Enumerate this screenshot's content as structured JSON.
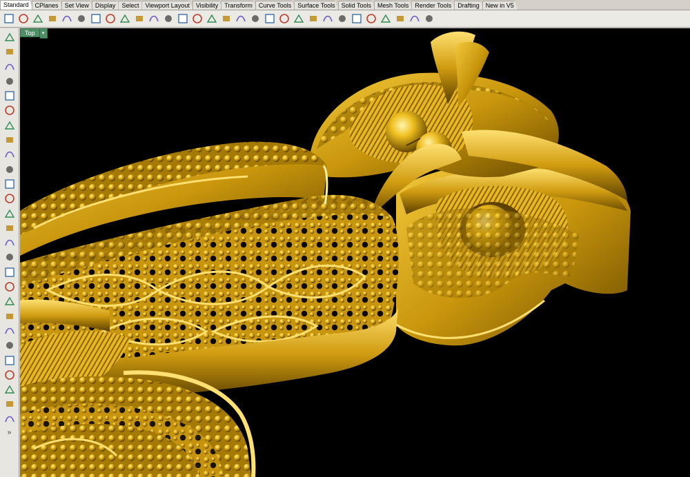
{
  "tabs": [
    {
      "label": "Standard",
      "active": true
    },
    {
      "label": "CPlanes"
    },
    {
      "label": "Set View"
    },
    {
      "label": "Display"
    },
    {
      "label": "Select"
    },
    {
      "label": "Viewport Layout"
    },
    {
      "label": "Visibility"
    },
    {
      "label": "Transform"
    },
    {
      "label": "Curve Tools"
    },
    {
      "label": "Surface Tools"
    },
    {
      "label": "Solid Tools"
    },
    {
      "label": "Mesh Tools"
    },
    {
      "label": "Render Tools"
    },
    {
      "label": "Drafting"
    },
    {
      "label": "New in V5"
    }
  ],
  "toolbar_icons": [
    "new-file-icon",
    "open-folder-icon",
    "save-icon",
    "print-icon",
    "import-icon",
    "cut-icon",
    "copy-icon",
    "paste-icon",
    "undo-icon",
    "pan-hand-icon",
    "rotate-view-icon",
    "zoom-icon",
    "zoom-window-icon",
    "zoom-extents-icon",
    "zoom-selected-icon",
    "viewport-grid-icon",
    "four-viewports-icon",
    "car-icon",
    "curve-icon",
    "points-icon",
    "select-filter-icon",
    "lock-icon",
    "light-bulb-icon",
    "layer-icon",
    "color-wheel-icon",
    "material-sphere-icon",
    "render-sphere-icon",
    "shaded-sphere-icon",
    "environment-sphere-icon",
    "teapot-icon"
  ],
  "sidebar_icons": [
    "select-arrow-icon",
    "point-icon",
    "polyline-icon",
    "curve-points-icon",
    "circle-icon",
    "ellipse-icon",
    "polygon-icon",
    "rectangle-icon",
    "arc-icon",
    "fillet-curve-icon",
    "control-points-icon",
    "surface-icon",
    "box-solid-icon",
    "boolean-union-icon",
    "extrude-icon",
    "surface-edit-icon",
    "mesh-icon",
    "dimension-icon",
    "transform-icon",
    "analyze-icon",
    "render-icon",
    "material-icon",
    "text-icon",
    "array-icon",
    "group-icon",
    "layer-manager-icon",
    "render-object-icon"
  ],
  "sidebar_more": "»",
  "viewport": {
    "name": "Top",
    "menu_arrow": "▾"
  },
  "colors": {
    "gold": "#d4a017",
    "gold_dark": "#7a5a00",
    "gold_light": "#ffe067",
    "viewport_bg": "#000000",
    "label_bg": "#4f8f67"
  }
}
